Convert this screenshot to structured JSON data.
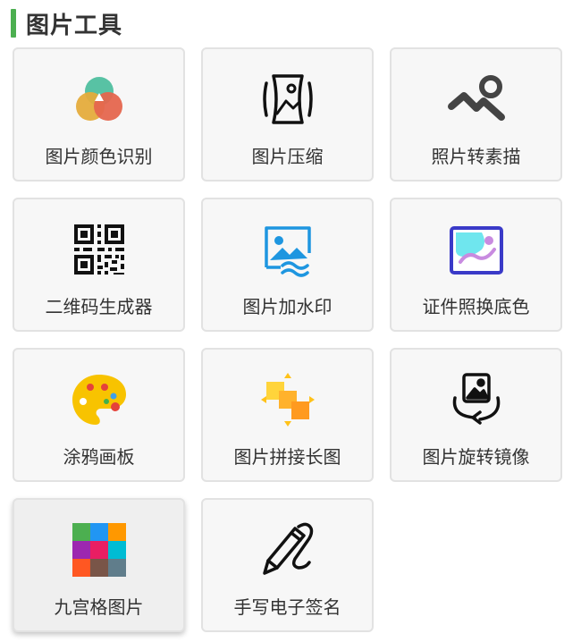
{
  "section": {
    "title": "图片工具",
    "accent_color": "#4caf50"
  },
  "tools": [
    {
      "label": "图片颜色识别",
      "icon": "color-circles-icon"
    },
    {
      "label": "图片压缩",
      "icon": "image-compress-icon"
    },
    {
      "label": "照片转素描",
      "icon": "sketch-landscape-icon"
    },
    {
      "label": "二维码生成器",
      "icon": "qr-code-icon"
    },
    {
      "label": "图片加水印",
      "icon": "watermark-image-icon"
    },
    {
      "label": "证件照换底色",
      "icon": "id-photo-background-icon"
    },
    {
      "label": "涂鸦画板",
      "icon": "paint-palette-icon"
    },
    {
      "label": "图片拼接长图",
      "icon": "image-stitch-icon"
    },
    {
      "label": "图片旋转镜像",
      "icon": "image-rotate-icon"
    },
    {
      "label": "九宫格图片",
      "icon": "nine-grid-icon"
    },
    {
      "label": "手写电子签名",
      "icon": "pen-signature-icon"
    }
  ]
}
